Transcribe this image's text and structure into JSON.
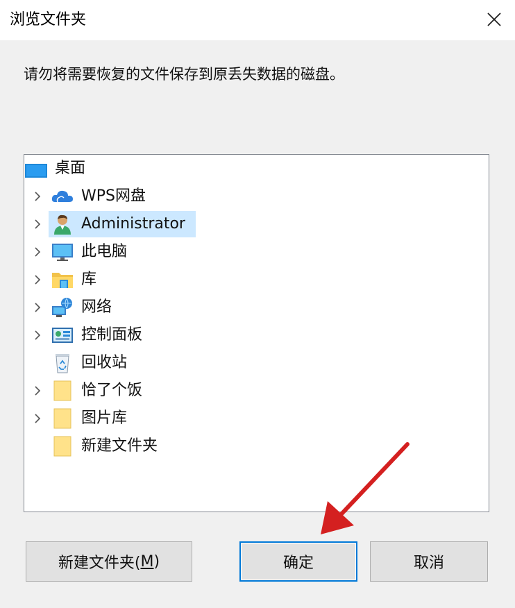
{
  "dialog": {
    "title": "浏览文件夹",
    "description": "请勿将需要恢复的文件保存到原丢失数据的磁盘。"
  },
  "tree": {
    "items": [
      {
        "label": "桌面",
        "icon": "desktop-icon",
        "expandable": false
      },
      {
        "label": "WPS网盘",
        "icon": "cloud-icon",
        "expandable": true
      },
      {
        "label": "Administrator",
        "icon": "user-icon",
        "expandable": true,
        "selected": true
      },
      {
        "label": "此电脑",
        "icon": "computer-icon",
        "expandable": true
      },
      {
        "label": "库",
        "icon": "library-icon",
        "expandable": true
      },
      {
        "label": "网络",
        "icon": "network-icon",
        "expandable": true
      },
      {
        "label": "控制面板",
        "icon": "control-panel-icon",
        "expandable": true
      },
      {
        "label": "回收站",
        "icon": "recycle-bin-icon",
        "expandable": false
      },
      {
        "label": "恰了个饭",
        "icon": "folder-icon",
        "expandable": true
      },
      {
        "label": "图片库",
        "icon": "folder-icon",
        "expandable": true
      },
      {
        "label": "新建文件夹",
        "icon": "folder-icon",
        "expandable": false
      }
    ]
  },
  "buttons": {
    "new_folder_text": "新建文件夹(",
    "new_folder_key": "M",
    "new_folder_close": ")",
    "ok": "确定",
    "cancel": "取消"
  },
  "colors": {
    "selection": "#cce8ff",
    "focus_border": "#0078d7",
    "annotation_arrow": "#d42020"
  }
}
